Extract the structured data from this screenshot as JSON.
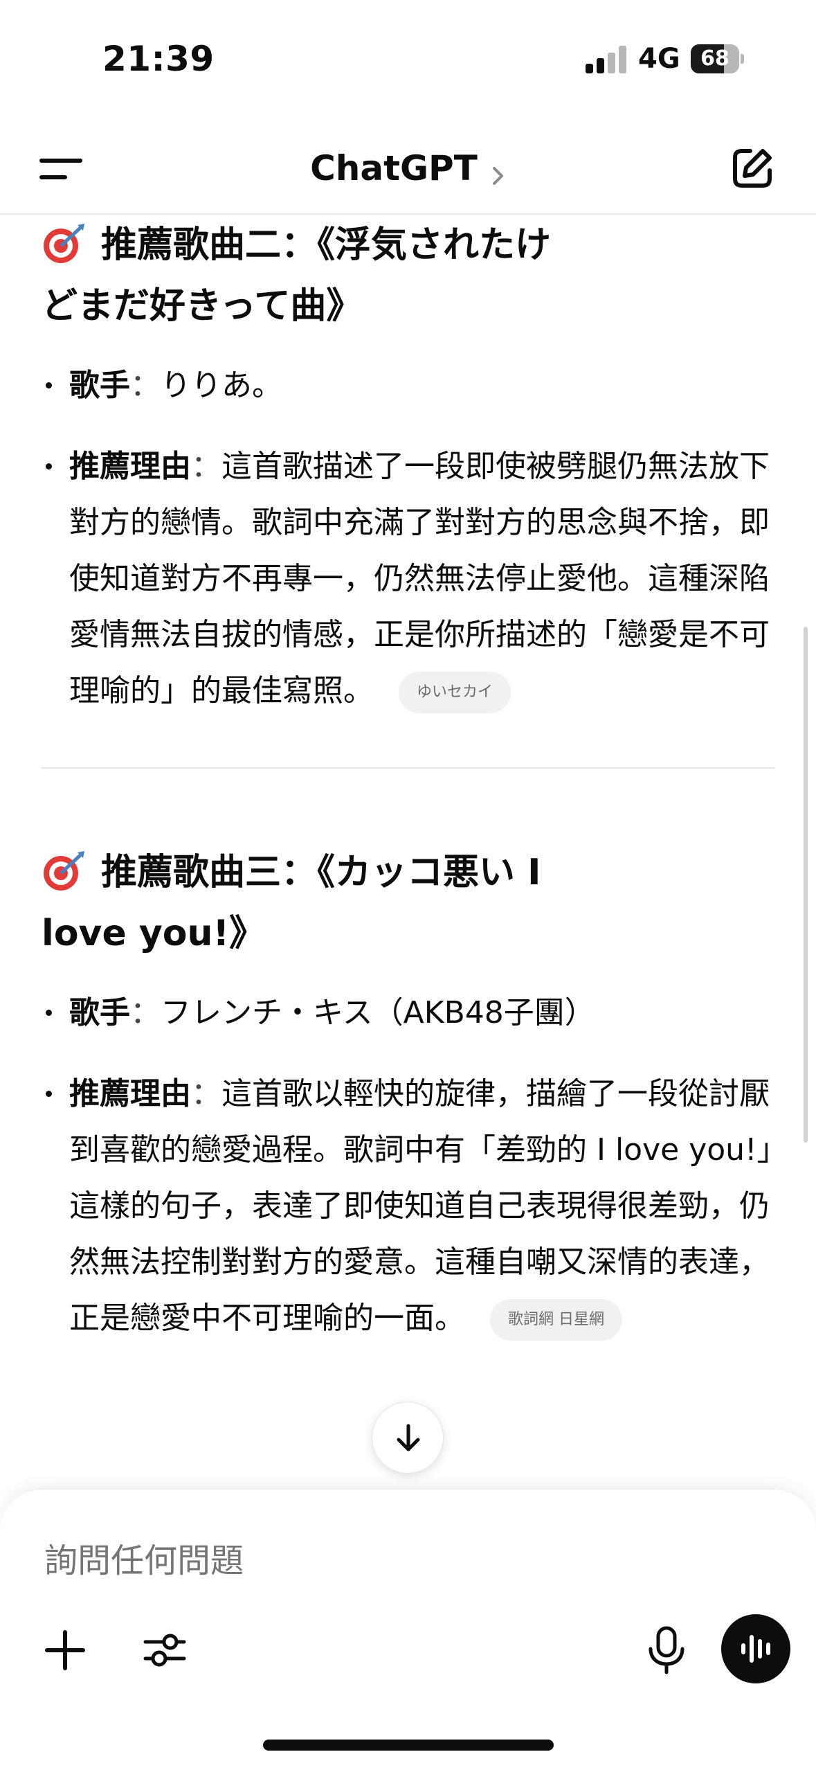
{
  "status_bar": {
    "time": "21:39",
    "network": "4G",
    "battery": "68",
    "battery_level": 0.68
  },
  "header": {
    "title": "ChatGPT"
  },
  "songs": [
    {
      "heading": "推薦歌曲二：《浮気されたけどまだ好きって曲》",
      "singer_label": "歌手",
      "singer": "りりあ。",
      "reason_label": "推薦理由",
      "reason": "這首歌描述了一段即使被劈腿仍無法放下對方的戀情。歌詞中充滿了對對方的思念與不捨，即使知道對方不再專一，仍然無法停止愛他。這種深陷愛情無法自拔的情感，正是你所描述的「戀愛是不可理喻的」的最佳寫照。",
      "citation": "ゆいセカイ"
    },
    {
      "heading": "推薦歌曲三：《カッコ悪い I love you!》",
      "singer_label": "歌手",
      "singer": "フレンチ・キス（AKB48子團）",
      "reason_label": "推薦理由",
      "reason": "這首歌以輕快的旋律，描繪了一段從討厭到喜歡的戀愛過程。歌詞中有「差勁的 I love you!」這樣的句子，表達了即使知道自己表現得很差勁，仍然無法控制對對方的愛意。這種自嘲又深情的表達，正是戀愛中不可理喻的一面。",
      "citation": "歌詞網 日星網"
    }
  ],
  "composer": {
    "placeholder": "詢問任何問題"
  },
  "icons": {
    "menu": "menu-icon",
    "chevron": "chevron-right-icon",
    "new_chat": "new-chat-icon",
    "emoji": "dart-target-icon",
    "scroll_down": "arrow-down-icon",
    "plus": "plus-icon",
    "tools": "sliders-icon",
    "mic": "microphone-icon",
    "voice": "voice-waveform-icon"
  }
}
